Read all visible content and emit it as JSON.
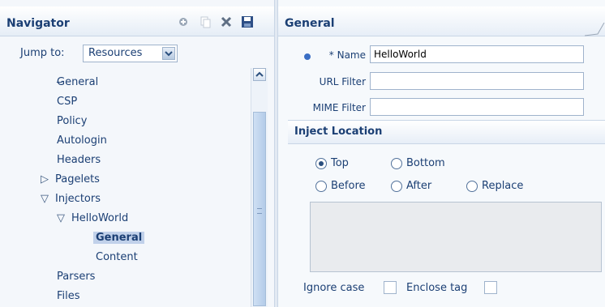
{
  "navigator": {
    "title": "Navigator",
    "jump_to": {
      "label": "Jump to:",
      "value": "Resources"
    },
    "tree": [
      {
        "label": "General",
        "depth": 1
      },
      {
        "label": "CSP",
        "depth": 1
      },
      {
        "label": "Policy",
        "depth": 1
      },
      {
        "label": "Autologin",
        "depth": 1
      },
      {
        "label": "Headers",
        "depth": 1
      },
      {
        "label": "Pagelets",
        "depth": 0,
        "twisty": "collapsed"
      },
      {
        "label": "Injectors",
        "depth": 0,
        "twisty": "expanded"
      },
      {
        "label": "HelloWorld",
        "depth": 1,
        "twisty": "expanded"
      },
      {
        "label": "General",
        "depth": 2,
        "selected": true
      },
      {
        "label": "Content",
        "depth": 2
      },
      {
        "label": "Parsers",
        "depth": 1
      },
      {
        "label": "Files",
        "depth": 1
      }
    ],
    "toolbar_icons": [
      "add-icon",
      "copy-icon",
      "delete-icon",
      "save-icon"
    ]
  },
  "general": {
    "title": "General",
    "fields": {
      "name_label": "* Name",
      "name_value": "HelloWorld",
      "url_filter_label": "URL Filter",
      "url_filter_value": "",
      "mime_filter_label": "MIME Filter",
      "mime_filter_value": ""
    },
    "inject_location": {
      "title": "Inject Location",
      "options": {
        "top": "Top",
        "bottom": "Bottom",
        "before": "Before",
        "after": "After",
        "replace": "Replace"
      },
      "selected": "Top"
    },
    "ignore_case_label": "Ignore case",
    "enclose_tag_label": "Enclose tag"
  }
}
